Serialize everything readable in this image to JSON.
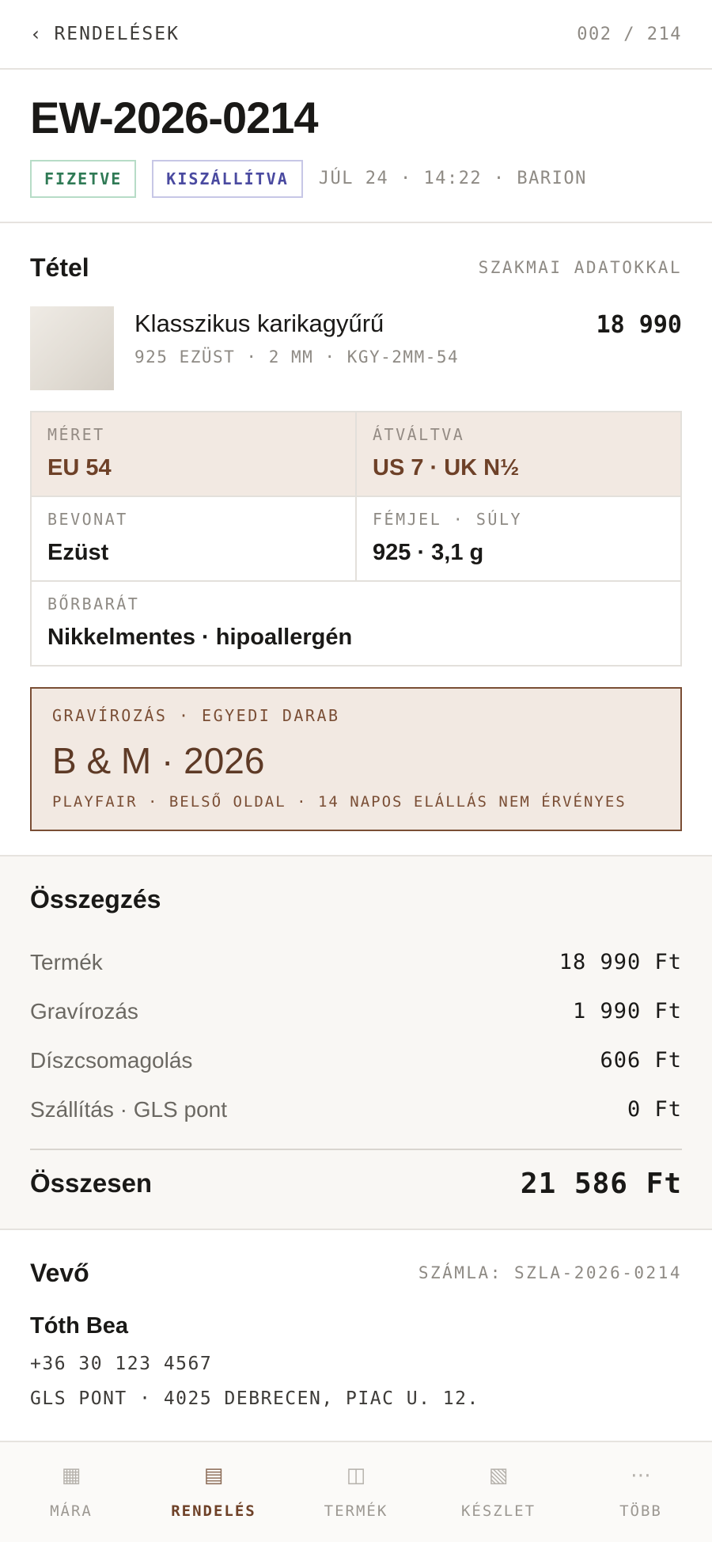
{
  "topbar": {
    "back_label": "RENDELÉSEK",
    "pager": "002 / 214"
  },
  "order": {
    "id": "EW-2026-0214",
    "badges": [
      "FIZETVE",
      "KISZÁLLÍTVA"
    ],
    "meta": "JÚL 24 · 14:22 · BARION"
  },
  "item_section": {
    "title": "Tétel",
    "aside": "SZAKMAI ADATOKKAL",
    "item": {
      "name": "Klasszikus karikagyűrű",
      "sub": "925 EZÜST · 2 MM · KGY-2MM-54",
      "price": "18 990"
    },
    "specs": {
      "size": {
        "label": "MÉRET",
        "value": "EU 54"
      },
      "converted": {
        "label": "ÁTVÁLTVA",
        "value": "US 7 · UK N½"
      },
      "plating": {
        "label": "BEVONAT",
        "value": "Ezüst"
      },
      "hallmark": {
        "label": "FÉMJEL · SÚLY",
        "value": "925 · 3,1 g"
      },
      "skin": {
        "label": "BŐRBARÁT",
        "value": "Nikkelmentes · hipoallergén"
      }
    },
    "engraving": {
      "label": "GRAVÍROZÁS · EGYEDI DARAB",
      "text": "B & M · 2026",
      "note": "PLAYFAIR · BELSŐ OLDAL · 14 NAPOS ELÁLLÁS NEM ÉRVÉNYES"
    }
  },
  "summary": {
    "title": "Összegzés",
    "rows": [
      {
        "label": "Termék",
        "value": "18 990 Ft"
      },
      {
        "label": "Gravírozás",
        "value": "1 990 Ft"
      },
      {
        "label": "Díszcsomagolás",
        "value": "606 Ft"
      },
      {
        "label": "Szállítás · GLS pont",
        "value": "0 Ft"
      }
    ],
    "total_label": "Összesen",
    "total_value": "21 586 Ft"
  },
  "customer": {
    "title": "Vevő",
    "invoice": "SZÁMLA: SZLA-2026-0214",
    "name": "Tóth Bea",
    "phone": "+36 30 123 4567",
    "address": "GLS PONT · 4025 DEBRECEN, PIAC U. 12."
  },
  "nav": {
    "items": [
      {
        "label": "MÁRA",
        "icon": "today-icon"
      },
      {
        "label": "RENDELÉS",
        "icon": "orders-icon"
      },
      {
        "label": "TERMÉK",
        "icon": "product-icon"
      },
      {
        "label": "KÉSZLET",
        "icon": "stock-icon"
      },
      {
        "label": "TÖBB",
        "icon": "more-icon"
      }
    ],
    "active": "RENDELÉS"
  },
  "colors": {
    "accent_brown": "#6e4128",
    "paid_green": "#2f7a55",
    "shipped_indigo": "#4a4aa0",
    "highlight_bg": "#f2e9e2"
  }
}
